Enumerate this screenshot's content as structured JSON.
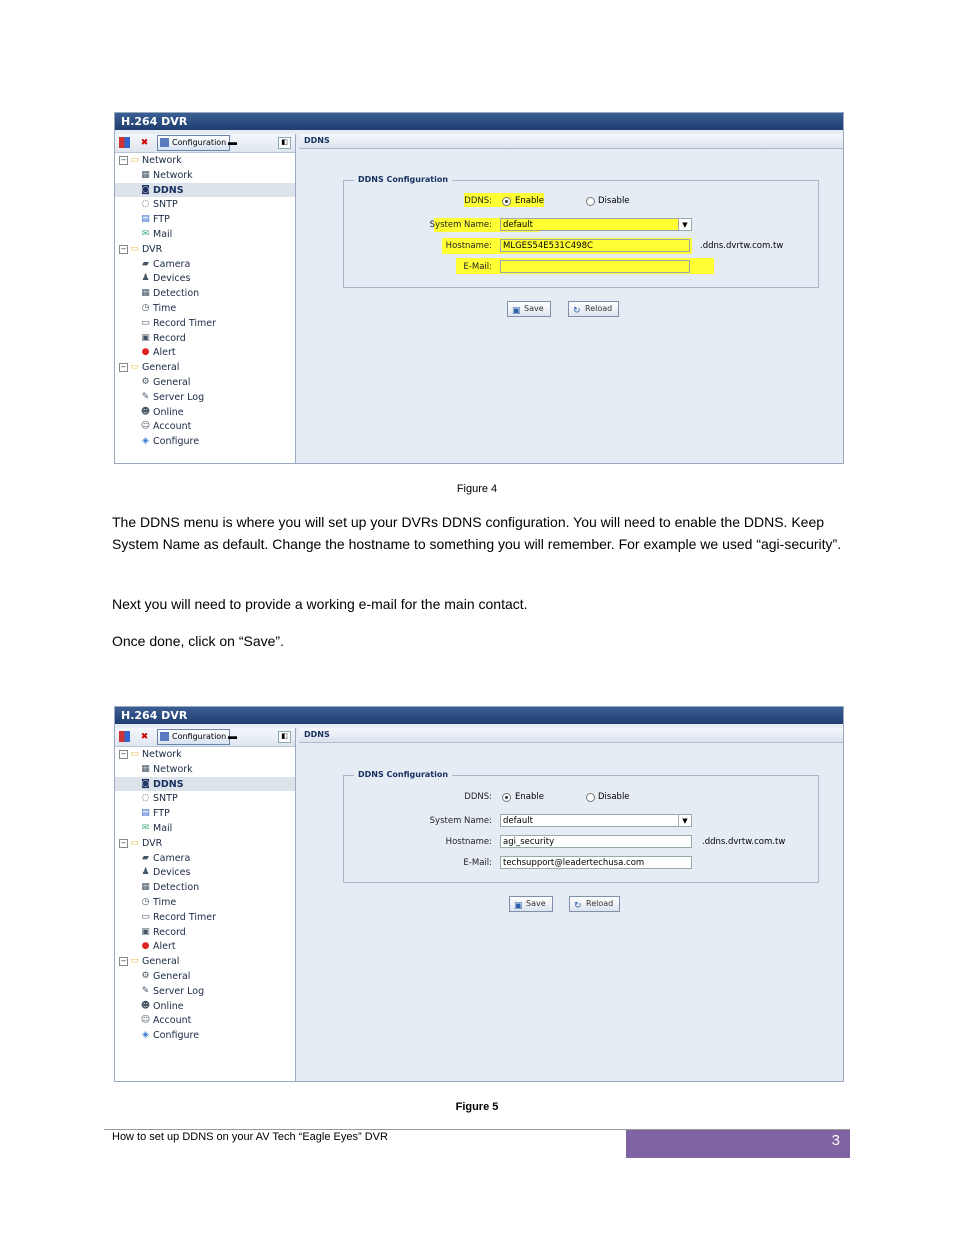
{
  "app_title": "H.264 DVR",
  "toolbar": {
    "config_label": "Configuration"
  },
  "tree": [
    {
      "label": "Network",
      "type": "grp",
      "icon": "folder-icon"
    },
    {
      "label": "Network",
      "type": "leaf",
      "icon": "network-icon"
    },
    {
      "label": "DDNS",
      "type": "leaf",
      "icon": "ddns-icon",
      "selected": true
    },
    {
      "label": "SNTP",
      "type": "leaf",
      "icon": "sntp-icon"
    },
    {
      "label": "FTP",
      "type": "leaf",
      "icon": "ftp-icon"
    },
    {
      "label": "Mail",
      "type": "leaf",
      "icon": "mail-icon"
    },
    {
      "label": "DVR",
      "type": "grp",
      "icon": "folder-icon"
    },
    {
      "label": "Camera",
      "type": "leaf",
      "icon": "camera-icon"
    },
    {
      "label": "Devices",
      "type": "leaf",
      "icon": "devices-icon"
    },
    {
      "label": "Detection",
      "type": "leaf",
      "icon": "detection-icon"
    },
    {
      "label": "Time",
      "type": "leaf",
      "icon": "clock-icon"
    },
    {
      "label": "Record Timer",
      "type": "leaf",
      "icon": "record-timer-icon"
    },
    {
      "label": "Record",
      "type": "leaf",
      "icon": "record-icon"
    },
    {
      "label": "Alert",
      "type": "leaf",
      "icon": "alert-icon"
    },
    {
      "label": "General",
      "type": "grp",
      "icon": "folder-icon"
    },
    {
      "label": "General",
      "type": "leaf",
      "icon": "gear-icon"
    },
    {
      "label": "Server Log",
      "type": "leaf",
      "icon": "log-icon"
    },
    {
      "label": "Online",
      "type": "leaf",
      "icon": "user-icon"
    },
    {
      "label": "Account",
      "type": "leaf",
      "icon": "account-icon"
    },
    {
      "label": "Configure",
      "type": "leaf",
      "icon": "configure-icon"
    }
  ],
  "panel_title": "DDNS",
  "legend": "DDNS Configuration",
  "labels": {
    "ddns": "DDNS:",
    "enable": "Enable",
    "disable": "Disable",
    "system_name": "System Name:",
    "hostname": "Hostname:",
    "email": "E-Mail:",
    "suffix": ".ddns.dvrtw.com.tw",
    "save": "Save",
    "reload": "Reload"
  },
  "fig4": {
    "system_name": "default",
    "hostname": "MLGES54E531C498C",
    "email": "",
    "caption": "Figure 4"
  },
  "fig5": {
    "system_name": "default",
    "hostname": "agi_security",
    "email": "techsupport@leadertechusa.com",
    "caption": "Figure 5"
  },
  "paragraphs": [
    "The DDNS menu is where you will set up your DVRs DDNS configuration. You will need to enable the DDNS. Keep System Name as default. Change the hostname to something you will remember. For example we used “agi-security”.",
    "Next you will need to provide a working e-mail for the main contact.",
    "Once done, click on “Save”."
  ],
  "footer": {
    "text": "How to set up DDNS on your AV Tech “Eagle Eyes” DVR",
    "page": "3"
  },
  "colors": {
    "highlight": "#ffff33",
    "footer_box": "#8064a2",
    "title_bar": "#2a4a7e"
  }
}
